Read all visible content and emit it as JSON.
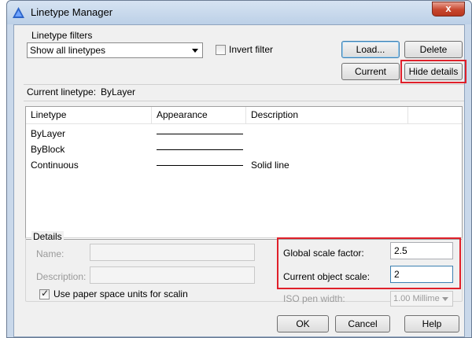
{
  "window": {
    "title": "Linetype Manager",
    "close_symbol": "x"
  },
  "filters": {
    "group_label": "Linetype filters",
    "selected": "Show all linetypes",
    "invert_label": "Invert filter",
    "invert_checked": false
  },
  "buttons": {
    "load": "Load...",
    "delete": "Delete",
    "current": "Current",
    "hide_details": "Hide details"
  },
  "current_linetype": {
    "label": "Current linetype:",
    "value": "ByLayer"
  },
  "table": {
    "columns": [
      "Linetype",
      "Appearance",
      "Description"
    ],
    "rows": [
      {
        "linetype": "ByLayer",
        "description": ""
      },
      {
        "linetype": "ByBlock",
        "description": ""
      },
      {
        "linetype": "Continuous",
        "description": "Solid line"
      }
    ]
  },
  "details": {
    "group_label": "Details",
    "name_label": "Name:",
    "description_label": "Description:",
    "paper_space_label": "Use paper space units for scalin",
    "paper_space_checked": true,
    "global_scale_label": "Global scale factor:",
    "global_scale_value": "2.5",
    "object_scale_label": "Current object scale:",
    "object_scale_value": "2",
    "iso_pen_label": "ISO pen width:",
    "iso_pen_value": "1.00 Millime"
  },
  "footer": {
    "ok": "OK",
    "cancel": "Cancel",
    "help": "Help"
  },
  "colors": {
    "highlight": "#e0202a",
    "titlebar": "#c9d8ea"
  }
}
